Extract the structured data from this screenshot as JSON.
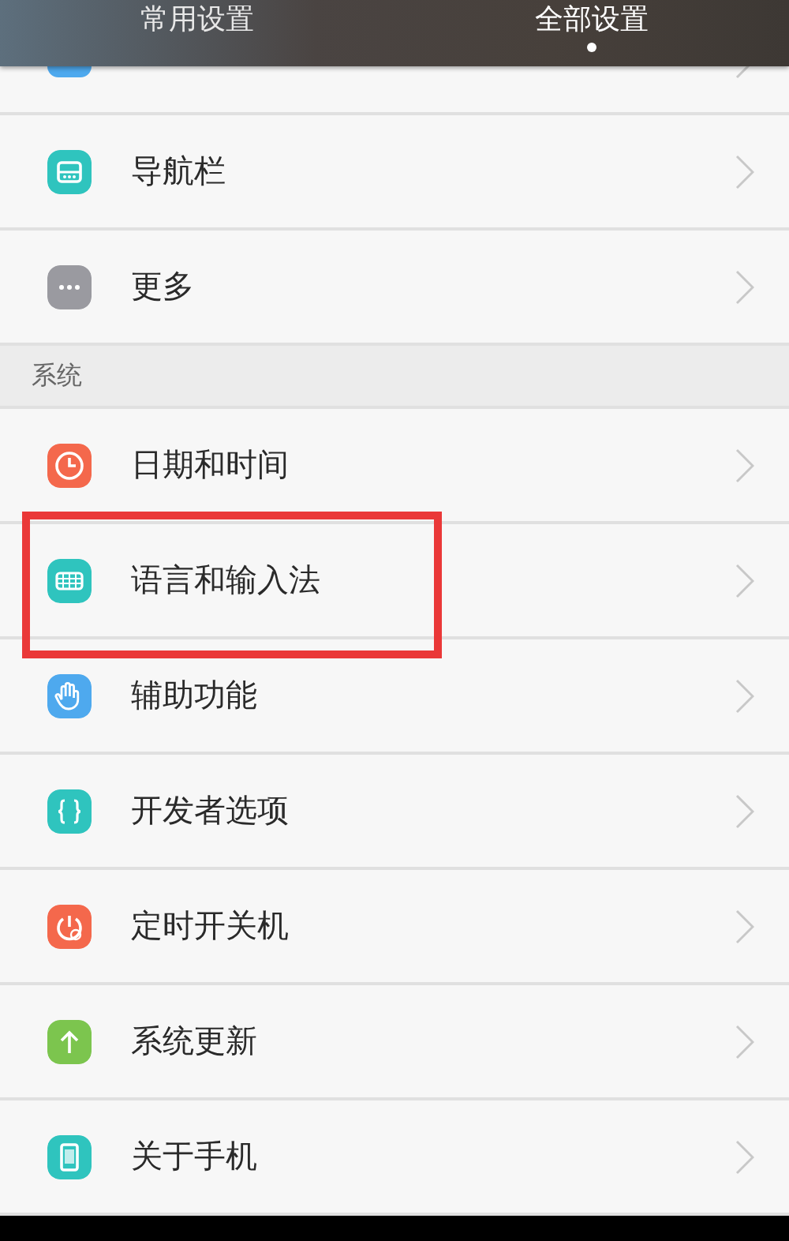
{
  "tabs": [
    {
      "label": "常用设置",
      "selected": false
    },
    {
      "label": "全部设置",
      "selected": true
    }
  ],
  "sections": [
    {
      "items": [
        {
          "kind": "cut",
          "color": "#4ea9ee"
        },
        {
          "kind": "navbar",
          "label": "导航栏",
          "color": "#2fc4be",
          "highlighted": false
        },
        {
          "kind": "more",
          "label": "更多",
          "color": "#9a9aa0",
          "highlighted": false
        }
      ]
    },
    {
      "title": "系统",
      "items": [
        {
          "kind": "clock",
          "label": "日期和时间",
          "color": "#f4684c",
          "highlighted": false
        },
        {
          "kind": "keyboard",
          "label": "语言和输入法",
          "color": "#2fc4be",
          "highlighted": true
        },
        {
          "kind": "hand",
          "label": "辅助功能",
          "color": "#4ea9ee",
          "highlighted": false
        },
        {
          "kind": "braces",
          "label": "开发者选项",
          "color": "#2fc4be",
          "highlighted": false
        },
        {
          "kind": "power",
          "label": "定时开关机",
          "color": "#f4684c",
          "highlighted": false
        },
        {
          "kind": "update",
          "label": "系统更新",
          "color": "#7cc54e",
          "highlighted": false
        },
        {
          "kind": "phone",
          "label": "关于手机",
          "color": "#2fc4be",
          "highlighted": false
        }
      ]
    }
  ]
}
